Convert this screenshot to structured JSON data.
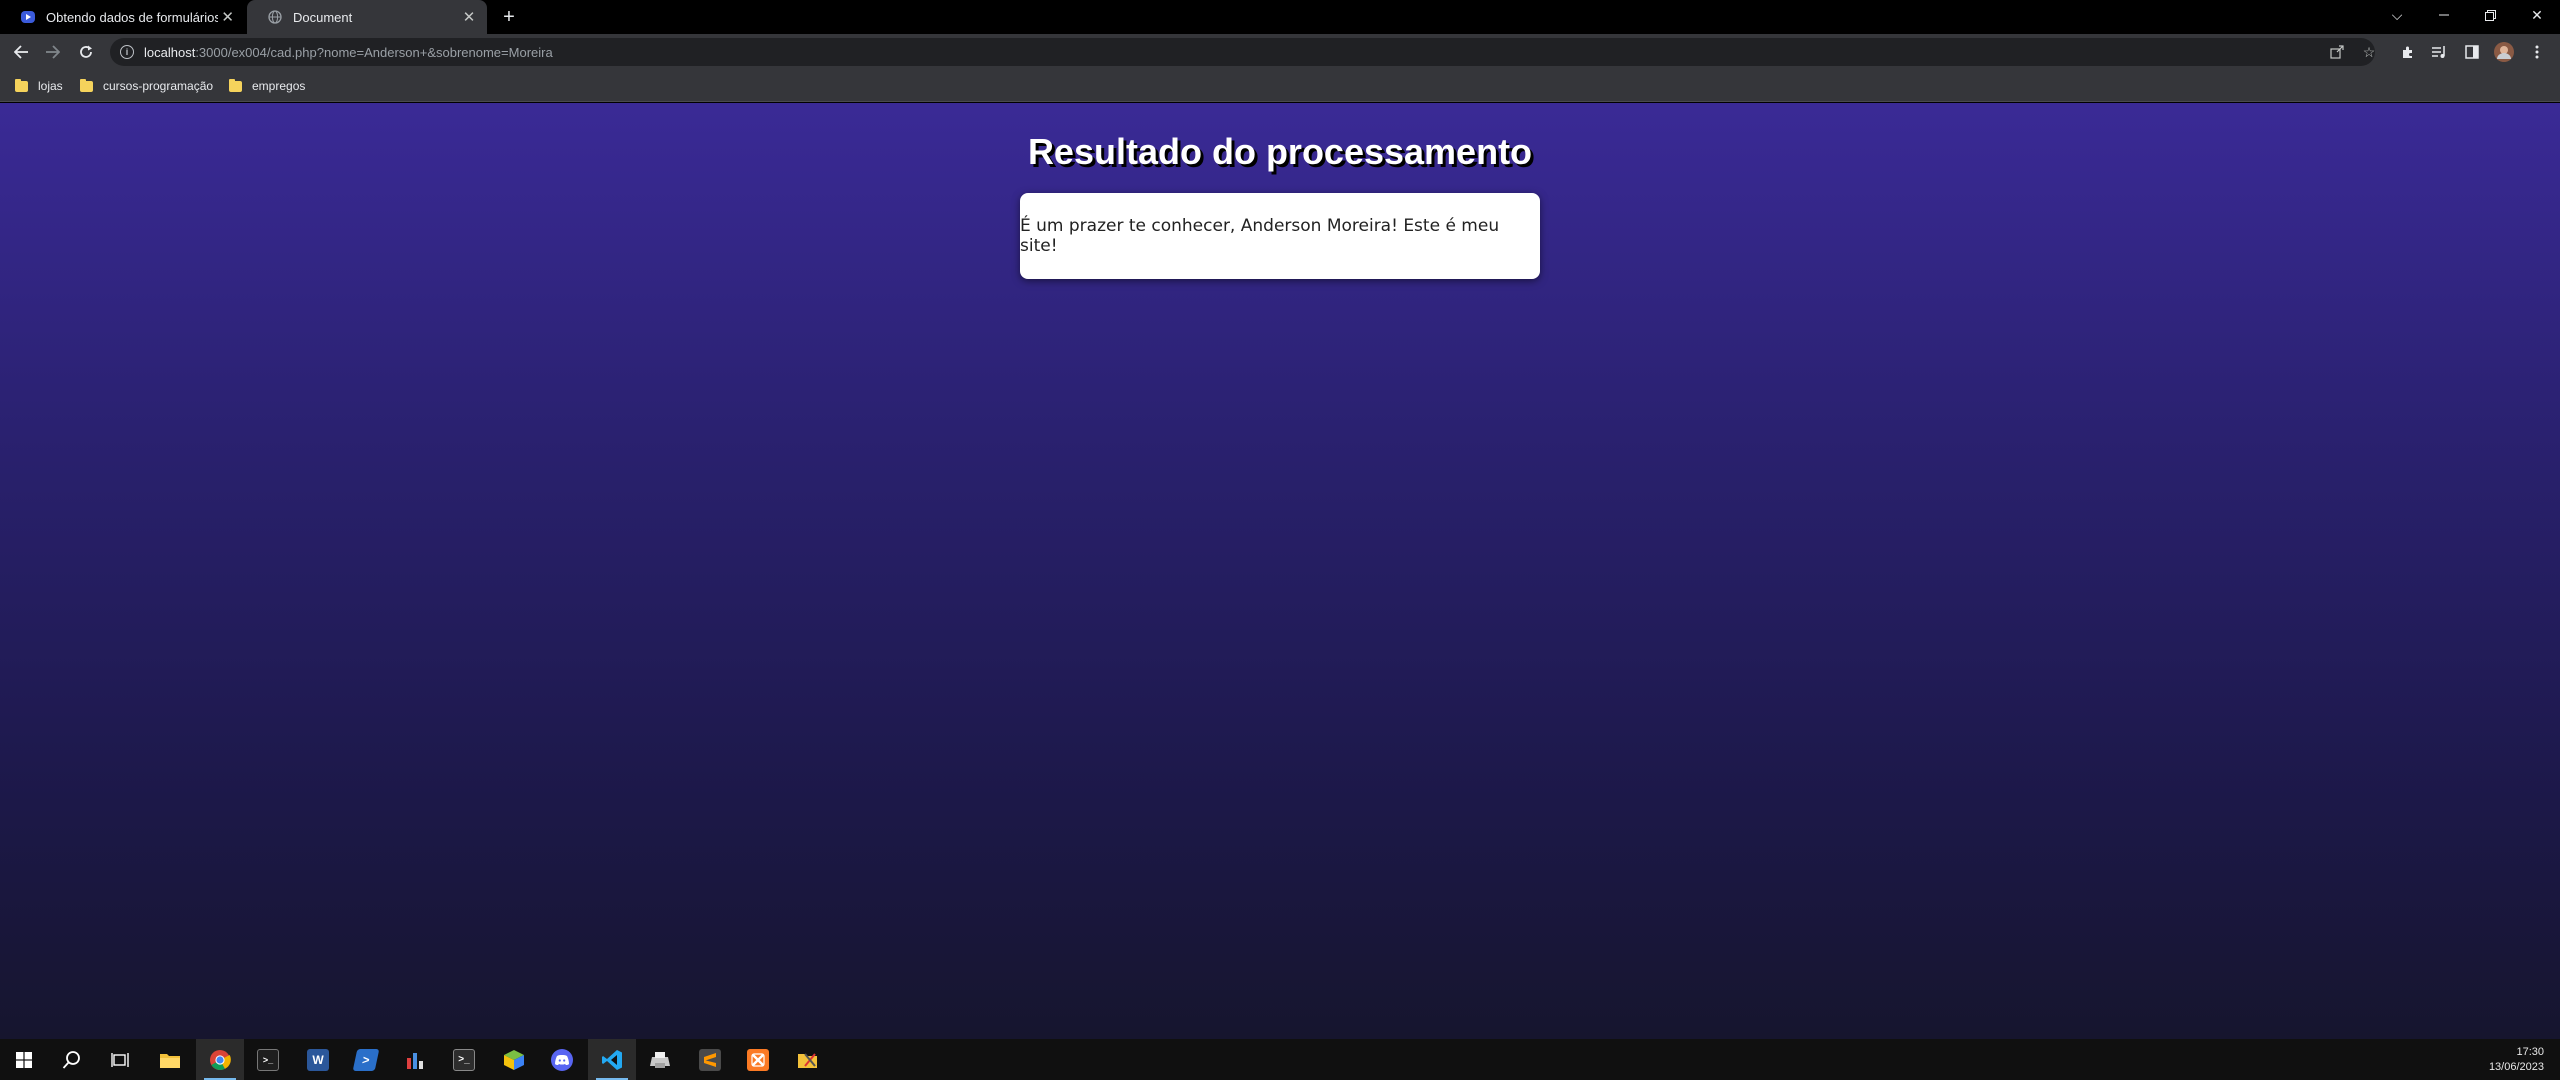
{
  "browser": {
    "tabs": [
      {
        "title": "Obtendo dados de formulários c",
        "favicon": "curso-em-video-icon"
      },
      {
        "title": "Document",
        "favicon": "globe-icon",
        "active": true
      }
    ],
    "address": {
      "host": "localhost",
      "rest": ":3000/ex004/cad.php?nome=Anderson+&sobrenome=Moreira"
    },
    "bookmarks": [
      {
        "label": "lojas"
      },
      {
        "label": "cursos-programação"
      },
      {
        "label": "empregos"
      }
    ]
  },
  "page": {
    "title": "Resultado do processamento",
    "message": "É um prazer te conhecer, Anderson Moreira! Este é meu site!"
  },
  "taskbar": {
    "time": "17:30",
    "date": "13/06/2023"
  },
  "colors": {
    "page_gradient_top": "#3a2a96",
    "page_gradient_bottom": "#16152e",
    "card_background": "#ffffff"
  }
}
